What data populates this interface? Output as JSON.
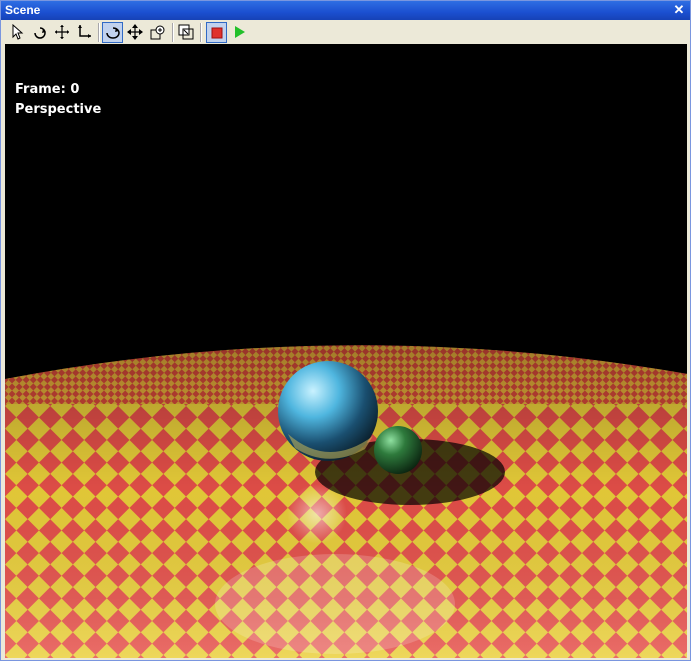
{
  "window": {
    "title": "Scene",
    "close_glyph": "✕"
  },
  "toolbar": {
    "buttons": [
      {
        "name": "select-icon",
        "active": false
      },
      {
        "name": "rotate-icon",
        "active": false
      },
      {
        "name": "move-icon",
        "active": false
      },
      {
        "name": "scale-icon",
        "active": false
      },
      {
        "name": "orbit-icon",
        "active": true
      },
      {
        "name": "pan-icon",
        "active": false
      },
      {
        "name": "zoom-icon",
        "active": false
      },
      {
        "name": "fit-view-icon",
        "active": false
      },
      {
        "name": "stop-icon",
        "active": true
      },
      {
        "name": "play-icon",
        "active": false
      }
    ]
  },
  "viewport": {
    "frame_label": "Frame: 0",
    "view_mode": "Perspective"
  },
  "colors": {
    "checker_red": "#e8504a",
    "checker_yellow": "#ecd13a",
    "background": "#000000"
  }
}
